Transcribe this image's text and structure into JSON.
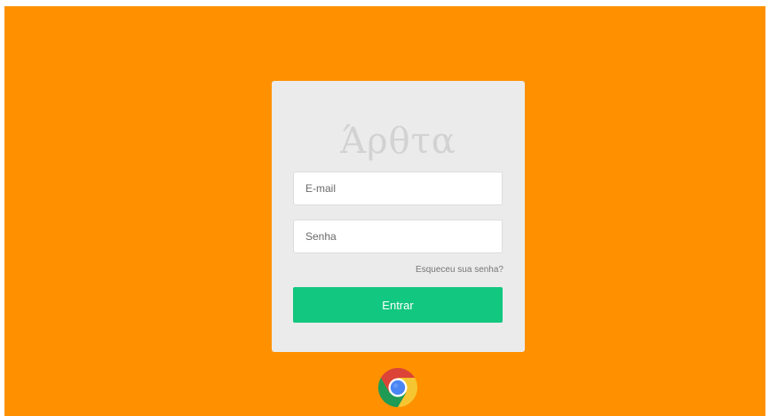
{
  "brand": {
    "logo_text": "Άρθτα"
  },
  "login_form": {
    "email_placeholder": "E-mail",
    "password_placeholder": "Senha",
    "forgot_link": "Esqueceu sua senha?",
    "submit_label": "Entrar"
  },
  "colors": {
    "background": "#ff9100",
    "card": "#ebebeb",
    "submit": "#12c77f",
    "logo": "#d2d2d2"
  },
  "icons": {
    "footer_icon": "chrome-icon"
  }
}
